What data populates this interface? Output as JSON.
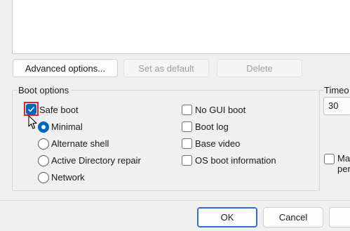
{
  "os_list": {
    "items": []
  },
  "buttons": {
    "advanced_options": "Advanced options...",
    "set_as_default": "Set as default",
    "delete": "Delete",
    "ok": "OK",
    "cancel": "Cancel"
  },
  "boot_options": {
    "title": "Boot options",
    "safe_boot": {
      "label": "Safe boot",
      "checked": true
    },
    "safe_boot_modes": [
      {
        "label": "Minimal",
        "selected": true
      },
      {
        "label": "Alternate shell",
        "selected": false
      },
      {
        "label": "Active Directory repair",
        "selected": false
      },
      {
        "label": "Network",
        "selected": false
      }
    ],
    "no_gui_boot": {
      "label": "No GUI boot",
      "checked": false
    },
    "boot_log": {
      "label": "Boot log",
      "checked": false
    },
    "base_video": {
      "label": "Base video",
      "checked": false
    },
    "os_boot_information": {
      "label": "OS boot information",
      "checked": false
    }
  },
  "timeout": {
    "label": "Timeo",
    "value": "30"
  },
  "make_permanent": {
    "label_line1": "Ma",
    "label_line2": "per",
    "checked": false
  },
  "colors": {
    "accent": "#0067c0",
    "focus_highlight": "#e0242a"
  }
}
